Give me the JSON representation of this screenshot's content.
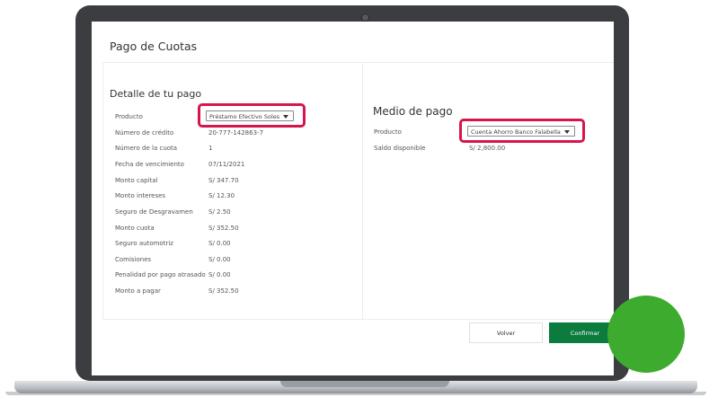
{
  "page": {
    "title": "Pago de Cuotas"
  },
  "detalle": {
    "title": "Detalle de tu pago",
    "producto_label": "Producto",
    "producto_value": "Préstamo Efectivo Soles",
    "rows": [
      {
        "label": "Número de crédito",
        "value": "20-777-142863-7"
      },
      {
        "label": "Número de la cuota",
        "value": "1"
      },
      {
        "label": "Fecha de vencimiento",
        "value": "07/11/2021"
      },
      {
        "label": "Monto capital",
        "value": "S/ 347.70"
      },
      {
        "label": "Monto intereses",
        "value": "S/ 12.30"
      },
      {
        "label": "Seguro de Desgravamen",
        "value": "S/ 2.50"
      },
      {
        "label": "Monto cuota",
        "value": "S/ 352.50"
      },
      {
        "label": "Seguro automotriz",
        "value": "S/ 0.00"
      },
      {
        "label": "Comisiones",
        "value": "S/ 0.00"
      },
      {
        "label": "Penalidad por pago atrasado",
        "value": "S/ 0.00"
      },
      {
        "label": "Monto a pagar",
        "value": "S/ 352.50"
      }
    ]
  },
  "medio": {
    "title": "Medio de pago",
    "producto_label": "Producto",
    "producto_value": "Cuenta Ahorro Banco Falabella",
    "saldo_label": "Saldo disponible",
    "saldo_value": "S/ 2,800.00"
  },
  "actions": {
    "volver": "Volver",
    "confirmar": "Confirmar"
  },
  "colors": {
    "primary": "#0b7b3e",
    "highlight": "#d6164b",
    "accent_circle": "#3cab2e"
  }
}
